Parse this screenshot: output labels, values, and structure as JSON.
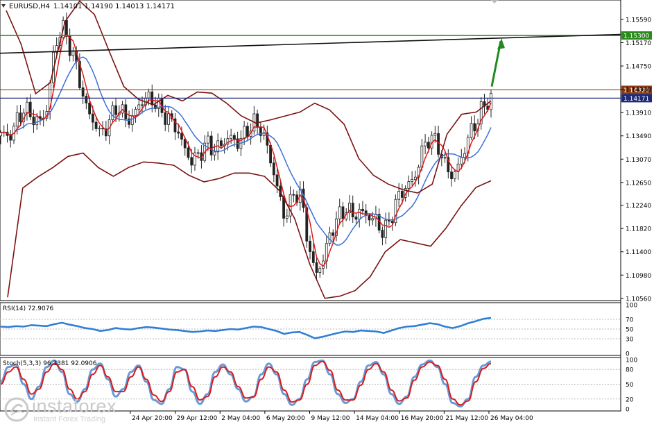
{
  "header": {
    "symbol": "EURUSD,H4",
    "ohlc": "1.14101 1.14190 1.14013 1.14171"
  },
  "indicators": {
    "rsi_label": "RSI(14) 72.9076",
    "stoch_label": "Stoch(5,3,3) 96.3381 92.0906"
  },
  "watermark": {
    "brand": "instaforex",
    "tagline": "Instant Forex Trading"
  },
  "colors": {
    "candle": "#222222",
    "bollinger": "#7b1111",
    "ma_fast": "#e01818",
    "ma_slow": "#3a6fd8",
    "rsi": "#2f7fd6",
    "stoch_main": "#6a9ad8",
    "stoch_signal": "#d81c1c",
    "level_green": "#2a8a1c",
    "level_navy": "#1c2a7a",
    "level_brown": "#8a3a12",
    "trend": "#111111",
    "arrow": "#1f8a1f"
  },
  "chart_data": [
    {
      "type": "line",
      "name": "price",
      "x_labels": [
        "24 Apr 20:00",
        "29 Apr 12:00",
        "2 May 04:00",
        "6 May 20:00",
        "9 May 12:00",
        "14 May 04:00",
        "16 May 20:00",
        "21 May 12:00",
        "26 May 04:00"
      ],
      "y_ticks": [
        1.1559,
        1.1517,
        1.1475,
        1.1433,
        1.1391,
        1.1349,
        1.1307,
        1.1265,
        1.1224,
        1.1182,
        1.114,
        1.1098,
        1.1056
      ],
      "ylim": [
        1.1052,
        1.1594
      ],
      "close_path": [
        1.1355,
        1.1345,
        1.1372,
        1.1398,
        1.1385,
        1.1372,
        1.1395,
        1.1505,
        1.1548,
        1.1512,
        1.1468,
        1.1405,
        1.1378,
        1.1352,
        1.1368,
        1.1402,
        1.1388,
        1.1375,
        1.1405,
        1.1418,
        1.1412,
        1.1392,
        1.1378,
        1.1362,
        1.1325,
        1.1302,
        1.1318,
        1.1336,
        1.1322,
        1.1338,
        1.1346,
        1.1336,
        1.1356,
        1.1372,
        1.1362,
        1.1318,
        1.1262,
        1.1202,
        1.1236,
        1.1252,
        1.1168,
        1.1098,
        1.1122,
        1.1172,
        1.1202,
        1.1218,
        1.1206,
        1.1212,
        1.1204,
        1.1196,
        1.1172,
        1.1205,
        1.1242,
        1.1258,
        1.1272,
        1.1322,
        1.1348,
        1.1335,
        1.1296,
        1.1275,
        1.1302,
        1.1346,
        1.1372,
        1.1402,
        1.1417
      ],
      "bollinger_upper": [
        1.1575,
        1.1515,
        1.1425,
        1.1445,
        1.1555,
        1.1592,
        1.1568,
        1.1502,
        1.1438,
        1.1415,
        1.1405,
        1.1422,
        1.1412,
        1.1428,
        1.1426,
        1.1408,
        1.1385,
        1.1372,
        1.1378,
        1.1385,
        1.1392,
        1.1408,
        1.1396,
        1.137,
        1.1308,
        1.1278,
        1.1262,
        1.1252,
        1.1246,
        1.1262,
        1.1352,
        1.1388,
        1.1392,
        1.1412
      ],
      "bollinger_lower": [
        1.1058,
        1.1255,
        1.1275,
        1.1292,
        1.1312,
        1.1318,
        1.1292,
        1.1276,
        1.1292,
        1.1302,
        1.13,
        1.1296,
        1.1278,
        1.1266,
        1.1272,
        1.1282,
        1.1282,
        1.1276,
        1.125,
        1.12,
        1.1118,
        1.1056,
        1.106,
        1.107,
        1.1095,
        1.114,
        1.1162,
        1.1156,
        1.115,
        1.1182,
        1.1222,
        1.1256,
        1.1268
      ],
      "levels": [
        {
          "value": 1.153,
          "label": "1.15300",
          "color": "#2a8a1c"
        },
        {
          "value": 1.1432,
          "label": "1.14320",
          "color": "#8a3a12"
        },
        {
          "value": 1.1417,
          "label": "1.14171",
          "color": "#1c2a7a"
        }
      ]
    },
    {
      "type": "line",
      "name": "RSI(14)",
      "ylim": [
        0,
        100
      ],
      "y_ticks": [
        100,
        70,
        50,
        30,
        0
      ],
      "values": [
        55,
        54,
        56,
        55,
        58,
        57,
        56,
        60,
        63,
        59,
        56,
        52,
        50,
        46,
        48,
        52,
        50,
        49,
        52,
        54,
        53,
        51,
        49,
        48,
        46,
        44,
        45,
        47,
        46,
        48,
        50,
        49,
        52,
        55,
        54,
        50,
        46,
        40,
        43,
        44,
        38,
        31,
        34,
        38,
        42,
        45,
        44,
        47,
        46,
        45,
        42,
        47,
        52,
        55,
        56,
        59,
        62,
        60,
        55,
        52,
        56,
        62,
        66,
        71,
        73
      ]
    },
    {
      "type": "line",
      "name": "Stoch(5,3,3)",
      "ylim": [
        0,
        100
      ],
      "y_ticks": [
        100,
        80,
        50,
        20,
        0
      ],
      "main": [
        55,
        85,
        90,
        50,
        20,
        45,
        85,
        98,
        75,
        30,
        15,
        40,
        80,
        92,
        60,
        25,
        40,
        75,
        88,
        55,
        18,
        10,
        40,
        85,
        80,
        35,
        10,
        30,
        75,
        90,
        70,
        40,
        15,
        25,
        70,
        92,
        70,
        30,
        8,
        20,
        60,
        95,
        98,
        70,
        30,
        12,
        20,
        55,
        88,
        95,
        70,
        30,
        10,
        25,
        65,
        90,
        98,
        85,
        50,
        12,
        5,
        20,
        65,
        88,
        96
      ],
      "signal": [
        50,
        75,
        85,
        60,
        30,
        40,
        75,
        92,
        80,
        40,
        20,
        35,
        70,
        88,
        65,
        35,
        35,
        65,
        85,
        60,
        28,
        15,
        35,
        75,
        80,
        45,
        18,
        25,
        65,
        85,
        75,
        45,
        22,
        24,
        60,
        85,
        75,
        38,
        14,
        18,
        50,
        88,
        96,
        78,
        38,
        18,
        18,
        48,
        80,
        92,
        75,
        38,
        16,
        22,
        58,
        85,
        95,
        88,
        60,
        20,
        8,
        16,
        55,
        82,
        92
      ]
    }
  ]
}
